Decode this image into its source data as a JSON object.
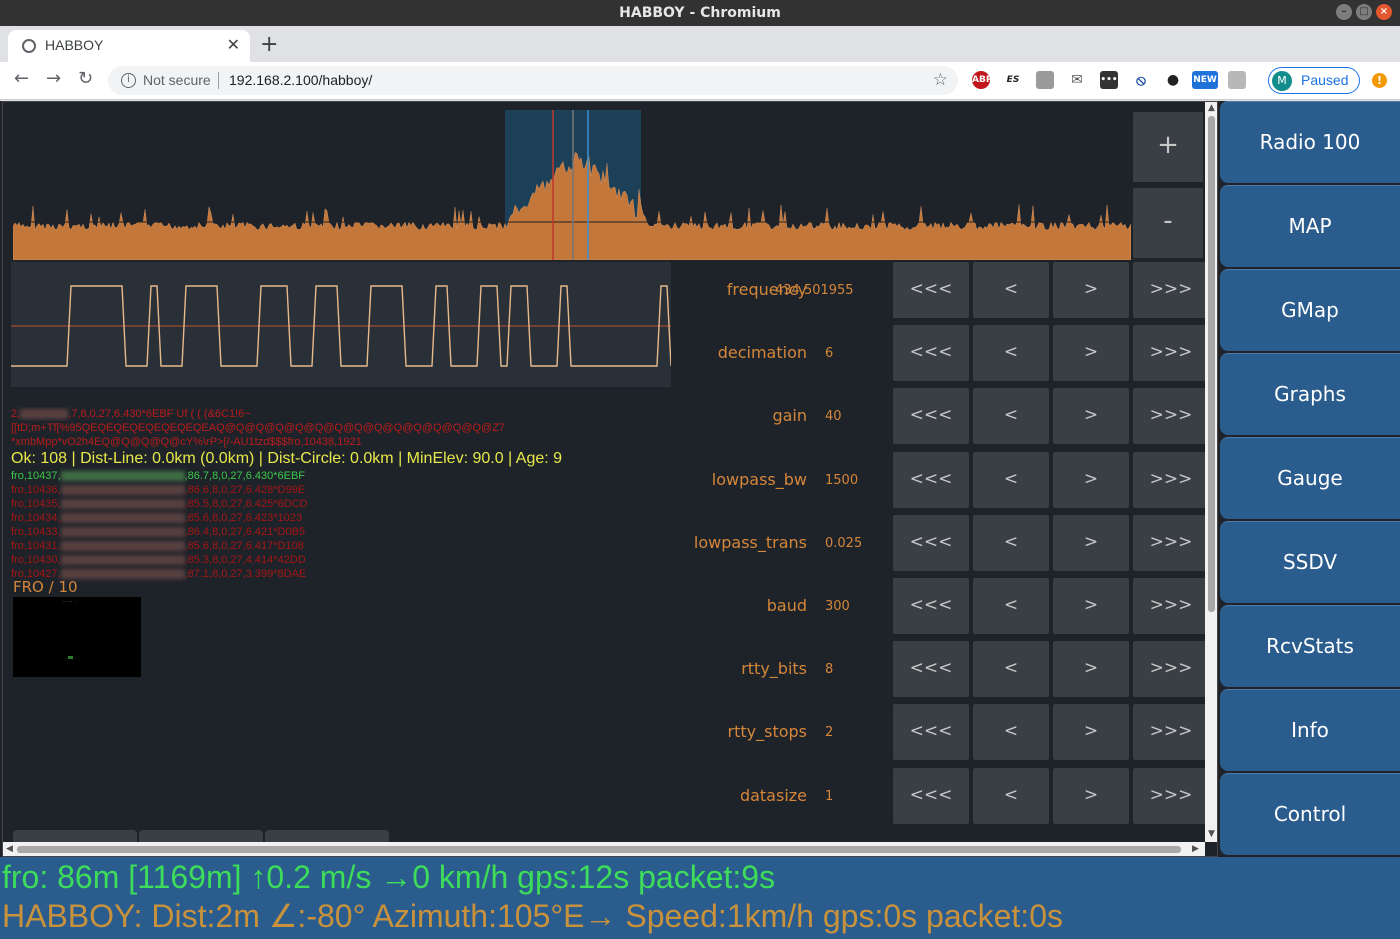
{
  "window": {
    "title": "HABBOY - Chromium"
  },
  "browser": {
    "tab_title": "HABBOY",
    "not_secure": "Not secure",
    "url": "192.168.2.100/habboy/",
    "profile_initial": "M",
    "profile_status": "Paused"
  },
  "spectrum": {
    "zoom_in": "+",
    "zoom_out": "-",
    "colors": {
      "fill": "#c4773a",
      "filter_band": "#1c5a80",
      "marker_red": "#c0392b",
      "marker_blue": "#3d8fd6"
    }
  },
  "params": [
    {
      "label": "frequency",
      "value": "434.501955"
    },
    {
      "label": "decimation",
      "value": "6"
    },
    {
      "label": "gain",
      "value": "40"
    },
    {
      "label": "lowpass_bw",
      "value": "1500"
    },
    {
      "label": "lowpass_trans",
      "value": "0.025"
    },
    {
      "label": "baud",
      "value": "300"
    },
    {
      "label": "rtty_bits",
      "value": "8"
    },
    {
      "label": "rtty_stops",
      "value": "2"
    },
    {
      "label": "datasize",
      "value": "1"
    }
  ],
  "step_buttons": {
    "fast_down": "<<<",
    "down": "<",
    "up": ">",
    "fast_up": ">>>"
  },
  "log": {
    "raw1": "2,",
    "raw1_tail": ",7,8,0,27,6.430*6EBF Uf ( ( (&6C1!6~",
    "raw2": "[[tD;m+Tf[%95QEQEQEQEQEQEQEQEAQ@Q@Q@Q@Q@Q@Q@Q@Q@Q@Q@Q@Q@Q@Z7",
    "raw3": "*xmbMpp*vO2h4EQ@Q@Q@Q@cY%\\rP>[/-AU1tzd$$$fro,10438,1921",
    "ok": "Ok: 108 | Dist-Line: 0.0km (0.0km) | Dist-Circle: 0.0km | MinElev: 90.0 | Age: 9",
    "latest_prefix": "fro,10437,",
    "latest_suffix": ",86.7,8,0,27,6.430*6EBF",
    "history": [
      {
        "prefix": "fro,10436,",
        "suffix": ",86.6,8,0,27,6.428*D99E"
      },
      {
        "prefix": "fro,10435,",
        "suffix": ",85.5,8,0,27,6.425*6DCD"
      },
      {
        "prefix": "fro,10434,",
        "suffix": ",85.6,8,0,27,6.423*1023"
      },
      {
        "prefix": "fro,10433,",
        "suffix": ",86.4,8,0,27,6.421*D0B5"
      },
      {
        "prefix": "fro,10431,",
        "suffix": ",85.6,8,0,27,6.417*D108"
      },
      {
        "prefix": "fro,10430,",
        "suffix": ",85.3,8,0,27,4.414*42DD"
      },
      {
        "prefix": "fro,10427,",
        "suffix": ",87.1,8,0,27,3.399*8DAE"
      }
    ],
    "fro_header": "FRO / 10"
  },
  "nav": [
    "Radio 100",
    "MAP",
    "GMap",
    "Graphs",
    "Gauge",
    "SSDV",
    "RcvStats",
    "Info",
    "Control"
  ],
  "status": {
    "line1": "fro: 86m [1169m] ↑0.2 m/s →0 km/h gps:12s packet:9s",
    "line2": "HABBOY: Dist:2m ∠:-80° Azimuth:105°E→ Speed:1km/h gps:0s packet:0s"
  }
}
